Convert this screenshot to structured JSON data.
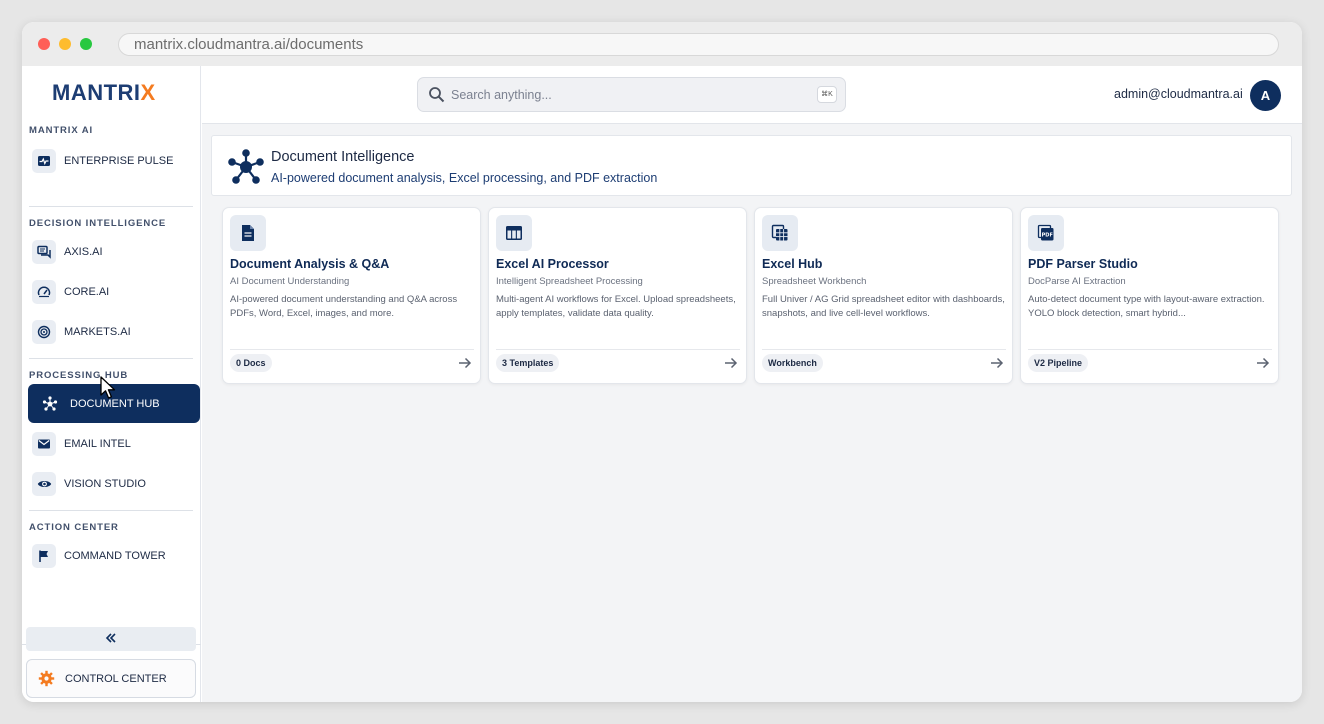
{
  "browser": {
    "url": "mantrix.cloudmantra.ai/documents"
  },
  "sidebar": {
    "logo": {
      "prefix": "MANTRI",
      "accent": "X"
    },
    "sections": [
      {
        "label": "MANTRIX AI",
        "items": [
          {
            "label": "ENTERPRISE PULSE",
            "icon": "pulse-icon"
          }
        ]
      },
      {
        "label": "DECISION INTELLIGENCE",
        "items": [
          {
            "label": "AXIS.AI",
            "icon": "chat-bubbles-icon"
          },
          {
            "label": "CORE.AI",
            "icon": "gauge-icon"
          },
          {
            "label": "MARKETS.AI",
            "icon": "target-icon"
          }
        ]
      },
      {
        "label": "PROCESSING HUB",
        "items": [
          {
            "label": "DOCUMENT HUB",
            "icon": "hub-network-icon",
            "active": true
          },
          {
            "label": "EMAIL INTEL",
            "icon": "mail-icon"
          },
          {
            "label": "VISION STUDIO",
            "icon": "eye-icon"
          }
        ]
      },
      {
        "label": "ACTION CENTER",
        "items": [
          {
            "label": "COMMAND TOWER",
            "icon": "flag-icon"
          }
        ]
      }
    ],
    "collapse_icon": "double-chevron-left-icon",
    "control_center": {
      "label": "CONTROL CENTER",
      "icon": "gear-icon"
    }
  },
  "topbar": {
    "search_placeholder": "Search anything...",
    "shortcut": "⌘K",
    "user_email": "admin@cloudmantra.ai",
    "avatar_initial": "A"
  },
  "header": {
    "title": "Document Intelligence",
    "subtitle": "AI-powered document analysis, Excel processing, and PDF extraction"
  },
  "cards": [
    {
      "title": "Document Analysis & Q&A",
      "subtitle": "AI Document Understanding",
      "description": "AI-powered document understanding and Q&A across PDFs, Word, Excel, images, and more.",
      "badge": "0 Docs",
      "icon": "document-icon"
    },
    {
      "title": "Excel AI Processor",
      "subtitle": "Intelligent Spreadsheet Processing",
      "description": "Multi-agent AI workflows for Excel. Upload spreadsheets, apply templates, validate data quality.",
      "badge": "3 Templates",
      "icon": "table-icon"
    },
    {
      "title": "Excel Hub",
      "subtitle": "Spreadsheet Workbench",
      "description": "Full Univer / AG Grid spreadsheet editor with dashboards, snapshots, and live cell-level workflows.",
      "badge": "Workbench",
      "icon": "spreadsheet-icon"
    },
    {
      "title": "PDF Parser Studio",
      "subtitle": "DocParse AI Extraction",
      "description": "Auto-detect document type with layout-aware extraction. YOLO block detection, smart hybrid...",
      "badge": "V2 Pipeline",
      "icon": "pdf-icon"
    }
  ],
  "colors": {
    "brand_navy": "#0e2e5e",
    "brand_orange": "#f47b20",
    "page_bg": "#f3f4f6"
  }
}
